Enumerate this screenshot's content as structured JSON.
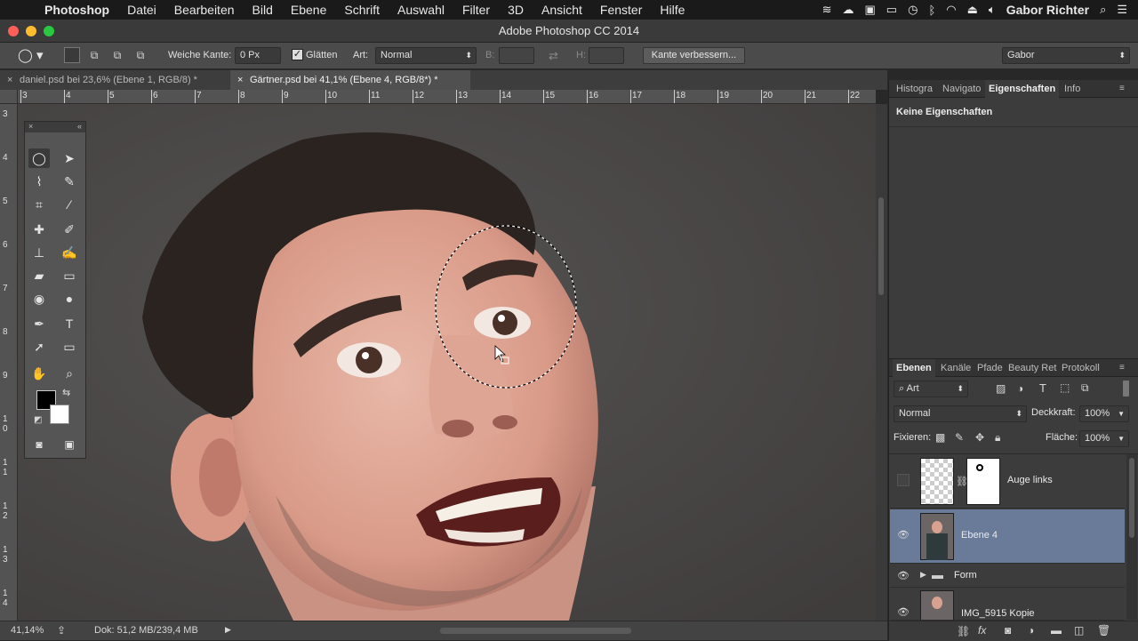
{
  "menubar": {
    "app": "Photoshop",
    "items": [
      "Datei",
      "Bearbeiten",
      "Bild",
      "Ebene",
      "Schrift",
      "Auswahl",
      "Filter",
      "3D",
      "Ansicht",
      "Fenster",
      "Hilfe"
    ],
    "user": "Gabor Richter"
  },
  "window": {
    "title": "Adobe Photoshop CC 2014"
  },
  "options": {
    "feather_label": "Weiche Kante:",
    "feather_value": "0 Px",
    "antialias_label": "Glätten",
    "style_label": "Art:",
    "style_value": "Normal",
    "width_label": "B:",
    "height_label": "H:",
    "refine_button": "Kante verbessern...",
    "workspace": "Gabor"
  },
  "tabs": [
    {
      "label": "daniel.psd bei 23,6% (Ebene 1, RGB/8) *",
      "active": false
    },
    {
      "label": "Gärtner.psd bei 41,1% (Ebene 4, RGB/8*) *",
      "active": true
    }
  ],
  "ruler_h": [
    "3",
    "4",
    "5",
    "6",
    "7",
    "8",
    "9",
    "10",
    "11",
    "12",
    "13",
    "14",
    "15",
    "16",
    "17",
    "18",
    "19",
    "20",
    "21",
    "22"
  ],
  "ruler_v": [
    "3",
    "4",
    "5",
    "6",
    "7",
    "8",
    "9",
    "1\n0",
    "1\n1",
    "1\n2",
    "1\n3",
    "1\n4"
  ],
  "status": {
    "zoom": "41,14%",
    "doc": "Dok: 51,2 MB/239,4 MB"
  },
  "panel_top": {
    "tabs": [
      "Histogra",
      "Navigato",
      "Eigenschaften",
      "Info"
    ],
    "properties_text": "Keine Eigenschaften"
  },
  "layers_panel": {
    "tabs": [
      "Ebenen",
      "Kanäle",
      "Pfade",
      "Beauty Ret",
      "Protokoll"
    ],
    "filter_label": "Art",
    "blend_mode": "Normal",
    "opacity_label": "Deckkraft:",
    "opacity_value": "100%",
    "lock_label": "Fixieren:",
    "fill_label": "Fläche:",
    "fill_value": "100%",
    "layers": [
      {
        "name": "Auge links",
        "visible": false,
        "selected": false
      },
      {
        "name": "Ebene 4",
        "visible": true,
        "selected": true
      },
      {
        "name": "Form",
        "visible": true,
        "selected": false
      },
      {
        "name": "IMG_5915 Kopie",
        "visible": true,
        "selected": false
      }
    ]
  },
  "colors": {
    "accent_selected_layer": "#6a7a99",
    "foreground": "#000000",
    "background": "#ffffff"
  }
}
